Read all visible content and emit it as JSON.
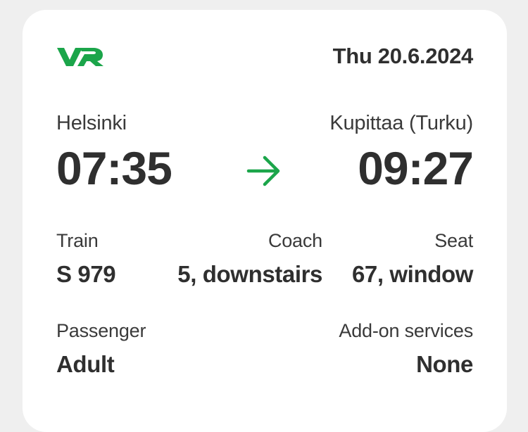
{
  "ticket": {
    "logo_text": "VR",
    "date": "Thu 20.6.2024",
    "origin": "Helsinki",
    "destination": "Kupittaa (Turku)",
    "departure_time": "07:35",
    "arrival_time": "09:27",
    "train_label": "Train",
    "train_value": "S 979",
    "coach_label": "Coach",
    "coach_value": "5, downstairs",
    "seat_label": "Seat",
    "seat_value": "67, window",
    "passenger_label": "Passenger",
    "passenger_value": "Adult",
    "addon_label": "Add-on services",
    "addon_value": "None"
  },
  "colors": {
    "brand_green": "#1ba54a",
    "text": "#2f2f2f",
    "background": "#efefef",
    "card": "#ffffff"
  },
  "icons": {
    "logo": "vr-logo-icon",
    "direction": "arrow-right-icon"
  }
}
